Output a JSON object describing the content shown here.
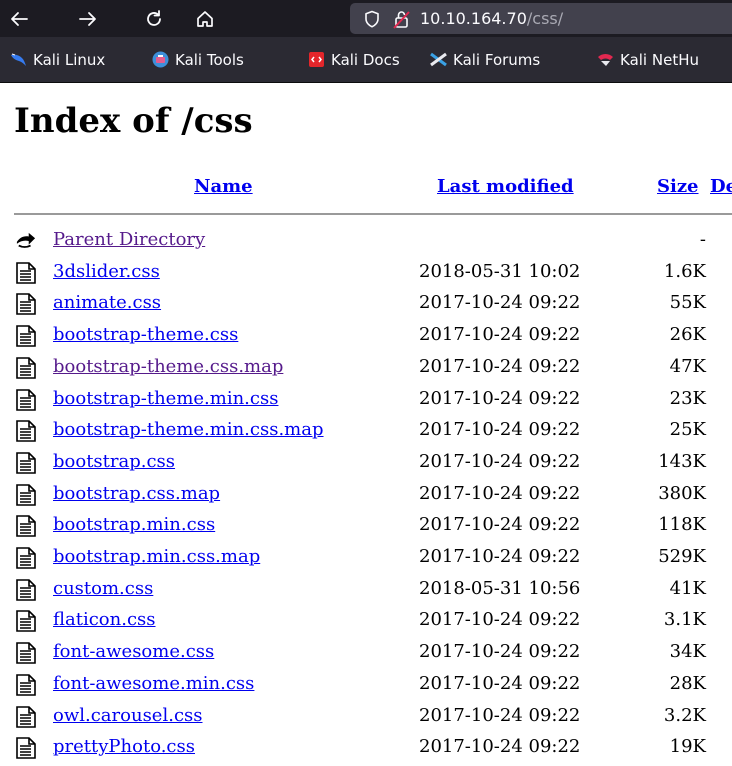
{
  "browser": {
    "url_host": "10.10.164.70",
    "url_path": "/css/",
    "bookmarks": [
      {
        "label": "Kali Linux",
        "icon": "kali-dragon-icon"
      },
      {
        "label": "Kali Tools",
        "icon": "kali-tools-icon"
      },
      {
        "label": "Kali Docs",
        "icon": "kali-docs-icon"
      },
      {
        "label": "Kali Forums",
        "icon": "kali-forums-icon"
      },
      {
        "label": "Kali NetHu",
        "icon": "kali-nethunter-icon"
      }
    ]
  },
  "page": {
    "title": "Index of /css",
    "columns": {
      "name": "Name",
      "last_modified": "Last modified",
      "size": "Size",
      "description": "De"
    },
    "parent": {
      "name": "Parent Directory",
      "date": "",
      "size": "-"
    },
    "files": [
      {
        "name": "3dslider.css",
        "date": "2018-05-31 10:02",
        "size": "1.6K"
      },
      {
        "name": "animate.css",
        "date": "2017-10-24 09:22",
        "size": "55K"
      },
      {
        "name": "bootstrap-theme.css",
        "date": "2017-10-24 09:22",
        "size": "26K"
      },
      {
        "name": "bootstrap-theme.css.map",
        "date": "2017-10-24 09:22",
        "size": "47K"
      },
      {
        "name": "bootstrap-theme.min.css",
        "date": "2017-10-24 09:22",
        "size": "23K"
      },
      {
        "name": "bootstrap-theme.min.css.map",
        "date": "2017-10-24 09:22",
        "size": "25K"
      },
      {
        "name": "bootstrap.css",
        "date": "2017-10-24 09:22",
        "size": "143K"
      },
      {
        "name": "bootstrap.css.map",
        "date": "2017-10-24 09:22",
        "size": "380K"
      },
      {
        "name": "bootstrap.min.css",
        "date": "2017-10-24 09:22",
        "size": "118K"
      },
      {
        "name": "bootstrap.min.css.map",
        "date": "2017-10-24 09:22",
        "size": "529K"
      },
      {
        "name": "custom.css",
        "date": "2018-05-31 10:56",
        "size": "41K"
      },
      {
        "name": "flaticon.css",
        "date": "2017-10-24 09:22",
        "size": "3.1K"
      },
      {
        "name": "font-awesome.css",
        "date": "2017-10-24 09:22",
        "size": "34K"
      },
      {
        "name": "font-awesome.min.css",
        "date": "2017-10-24 09:22",
        "size": "28K"
      },
      {
        "name": "owl.carousel.css",
        "date": "2017-10-24 09:22",
        "size": "3.2K"
      },
      {
        "name": "prettyPhoto.css",
        "date": "2017-10-24 09:22",
        "size": "19K"
      }
    ]
  },
  "colors": {
    "link": "#0000ee",
    "visited_link": "#551a8b",
    "toolbar": "#1c1b22",
    "bookmarks_bar": "#2b2a33"
  }
}
